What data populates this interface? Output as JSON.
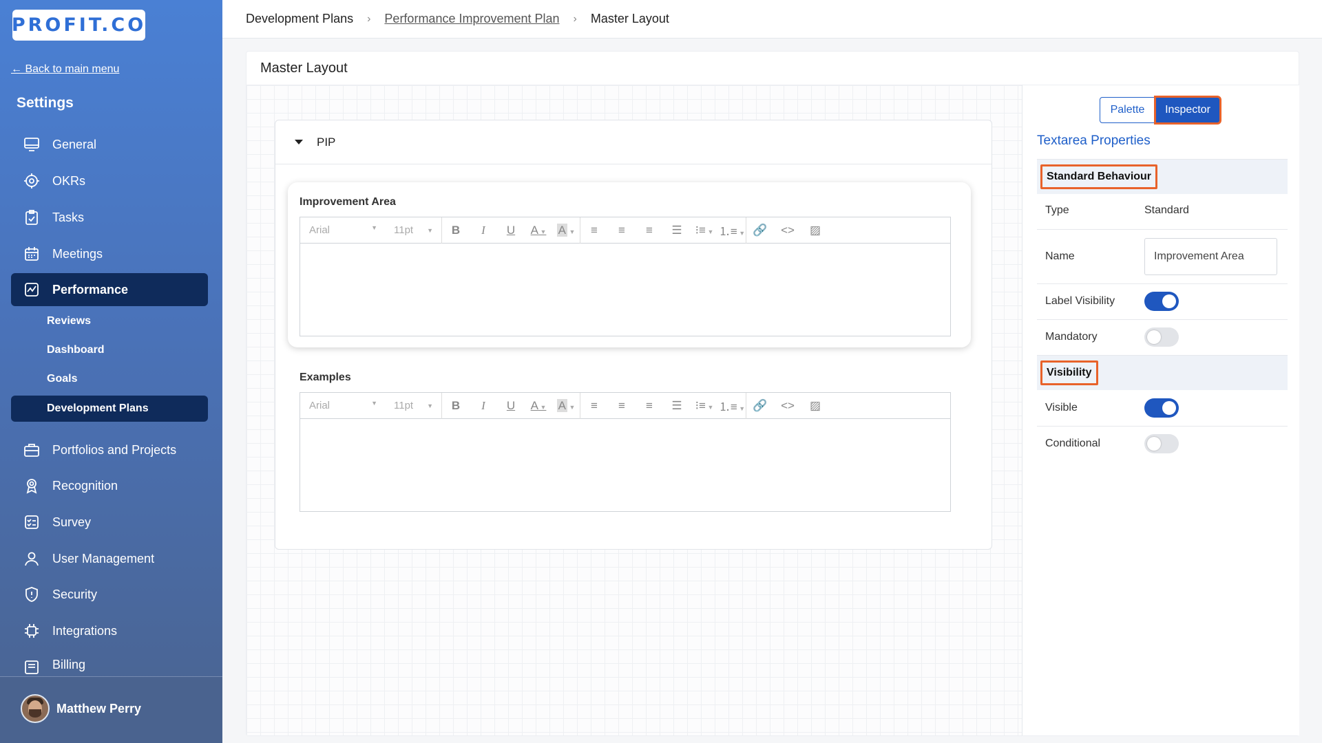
{
  "app": {
    "logo_text": "PROFIT.CO"
  },
  "sidebar": {
    "back_label": "← Back to main menu",
    "title": "Settings",
    "items": [
      {
        "label": "General",
        "icon": "monitor-icon"
      },
      {
        "label": "OKRs",
        "icon": "target-icon"
      },
      {
        "label": "Tasks",
        "icon": "clipboard-check-icon"
      },
      {
        "label": "Meetings",
        "icon": "calendar-icon"
      },
      {
        "label": "Performance",
        "icon": "chart-line-icon",
        "active": true
      },
      {
        "label": "Portfolios and Projects",
        "icon": "briefcase-icon"
      },
      {
        "label": "Recognition",
        "icon": "badge-icon"
      },
      {
        "label": "Survey",
        "icon": "checklist-icon"
      },
      {
        "label": "User Management",
        "icon": "user-icon"
      },
      {
        "label": "Security",
        "icon": "shield-icon"
      },
      {
        "label": "Integrations",
        "icon": "chip-icon"
      },
      {
        "label": "Billing",
        "icon": "billing-icon"
      }
    ],
    "sub_items": [
      {
        "label": "Reviews"
      },
      {
        "label": "Dashboard"
      },
      {
        "label": "Goals"
      },
      {
        "label": "Development Plans",
        "active": true
      }
    ],
    "user_name": "Matthew Perry"
  },
  "breadcrumb": {
    "items": [
      "Development Plans",
      "Performance Improvement Plan",
      "Master Layout"
    ],
    "separator": "›"
  },
  "main": {
    "title": "Master Layout",
    "section": {
      "title": "PIP",
      "fields": [
        {
          "label": "Improvement Area"
        },
        {
          "label": "Examples"
        }
      ]
    },
    "toolbar": {
      "font": "Arial",
      "size": "11pt"
    }
  },
  "inspector": {
    "tabs": [
      "Palette",
      "Inspector"
    ],
    "active_tab": "Inspector",
    "title": "Textarea Properties",
    "groups": {
      "standard": "Standard Behaviour",
      "visibility": "Visibility"
    },
    "props": {
      "type_label": "Type",
      "type_value": "Standard",
      "name_label": "Name",
      "name_value": "Improvement Area",
      "label_visibility_label": "Label Visibility",
      "label_visibility_on": true,
      "mandatory_label": "Mandatory",
      "mandatory_on": false,
      "visible_label": "Visible",
      "visible_on": true,
      "conditional_label": "Conditional",
      "conditional_on": false
    }
  },
  "colors": {
    "accent": "#1f57bf",
    "highlight": "#e8622a",
    "nav_active": "#0f2b5b"
  }
}
